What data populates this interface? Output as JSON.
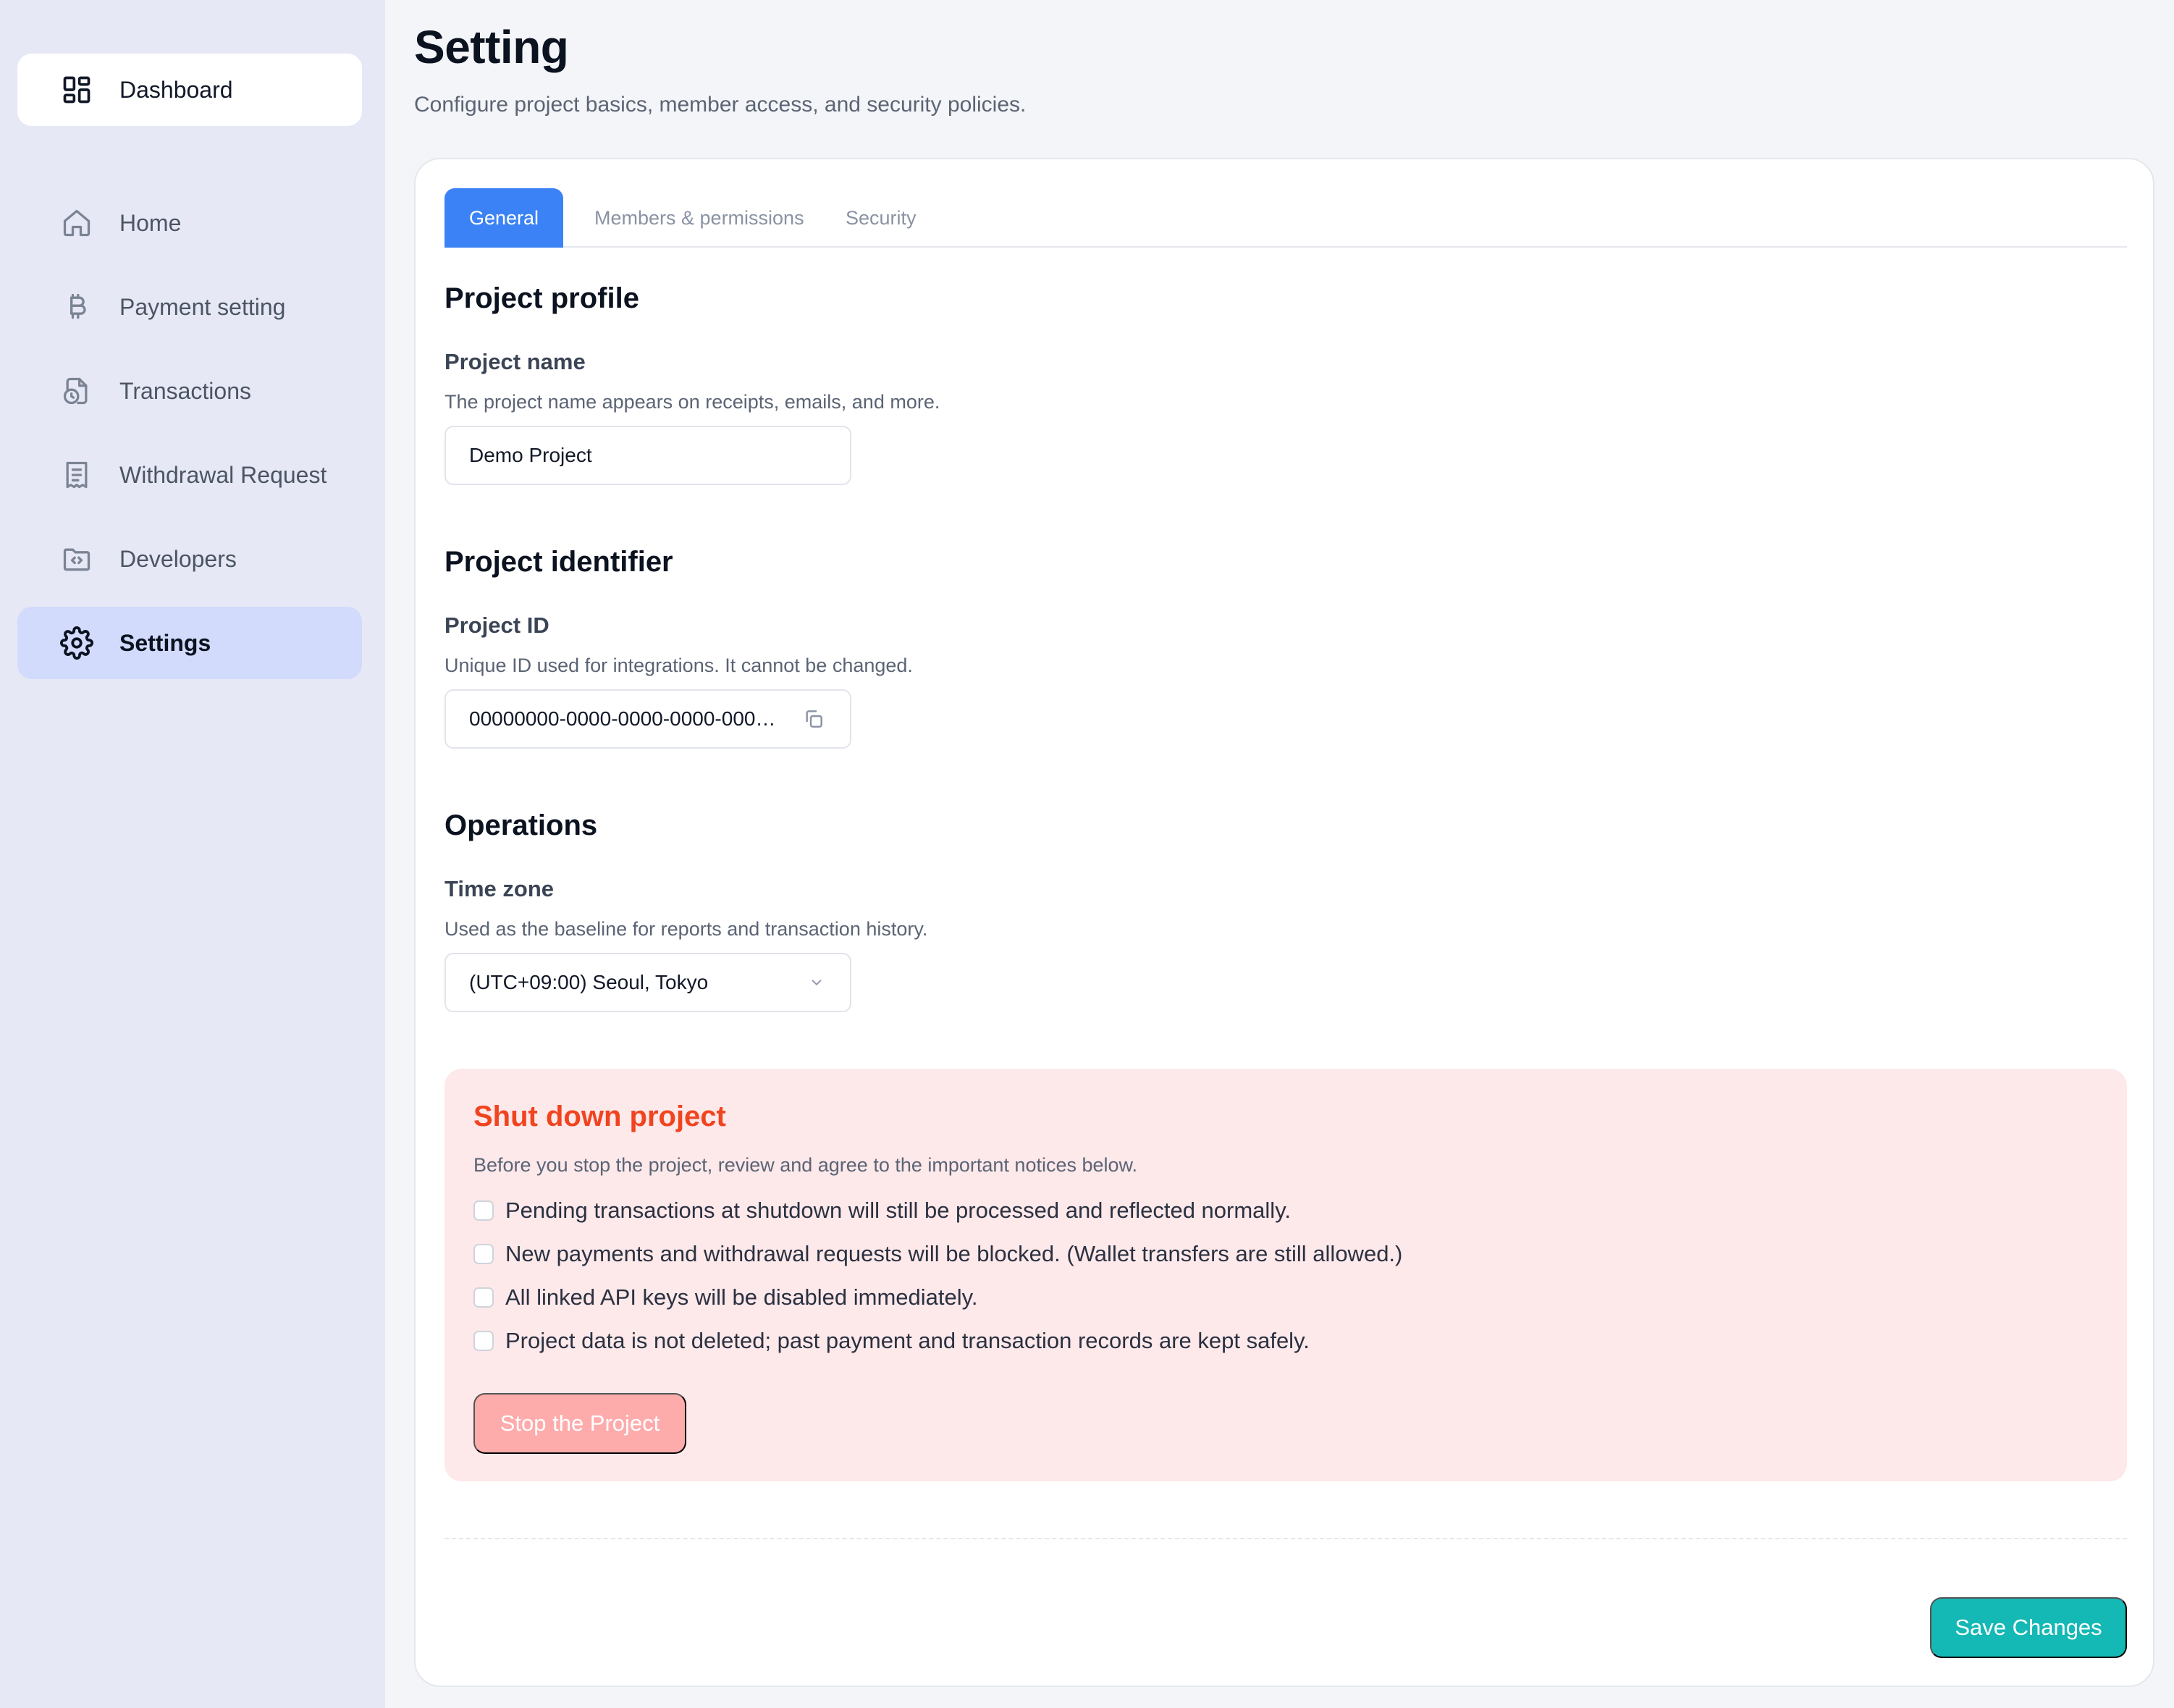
{
  "sidebar": {
    "dashboard": {
      "label": "Dashboard",
      "icon": "dashboard-grid-icon"
    },
    "items": [
      {
        "label": "Home",
        "icon": "home-icon"
      },
      {
        "label": "Payment setting",
        "icon": "bitcoin-icon"
      },
      {
        "label": "Transactions",
        "icon": "document-clock-icon"
      },
      {
        "label": "Withdrawal Request",
        "icon": "receipt-icon"
      },
      {
        "label": "Developers",
        "icon": "code-folder-icon"
      },
      {
        "label": "Settings",
        "icon": "gear-icon",
        "active": true
      }
    ]
  },
  "header": {
    "title": "Setting",
    "subtitle": "Configure project basics, member access, and security policies."
  },
  "tabs": [
    {
      "label": "General",
      "active": true
    },
    {
      "label": "Members & permissions"
    },
    {
      "label": "Security"
    }
  ],
  "profile": {
    "heading": "Project profile",
    "name_label": "Project name",
    "name_help": "The project name appears on receipts, emails, and more.",
    "name_value": "Demo Project"
  },
  "identifier": {
    "heading": "Project identifier",
    "id_label": "Project ID",
    "id_help": "Unique ID used for integrations. It cannot be changed.",
    "id_value": "00000000-0000-0000-0000-000…"
  },
  "operations": {
    "heading": "Operations",
    "tz_label": "Time zone",
    "tz_help": "Used as the baseline for reports and transaction history.",
    "tz_value": "(UTC+09:00) Seoul, Tokyo"
  },
  "shutdown": {
    "title": "Shut down project",
    "description": "Before you stop the project, review and agree to the important notices below.",
    "checks": [
      "Pending transactions at shutdown will still be processed and reflected normally.",
      "New payments and withdrawal requests will be blocked. (Wallet transfers are still allowed.)",
      "All linked API keys will be disabled immediately.",
      "Project data is not deleted; past payment and transaction records are kept safely."
    ],
    "button": "Stop the Project"
  },
  "actions": {
    "save": "Save Changes"
  },
  "colors": {
    "accent": "#3b82f6",
    "sidebar_bg": "#e7e8f6",
    "active_nav": "#d2dbfb",
    "danger_title": "#f0441f",
    "danger_bg": "#fde8ea",
    "stop_button": "#feabac",
    "save_button": "#14b8b5"
  }
}
